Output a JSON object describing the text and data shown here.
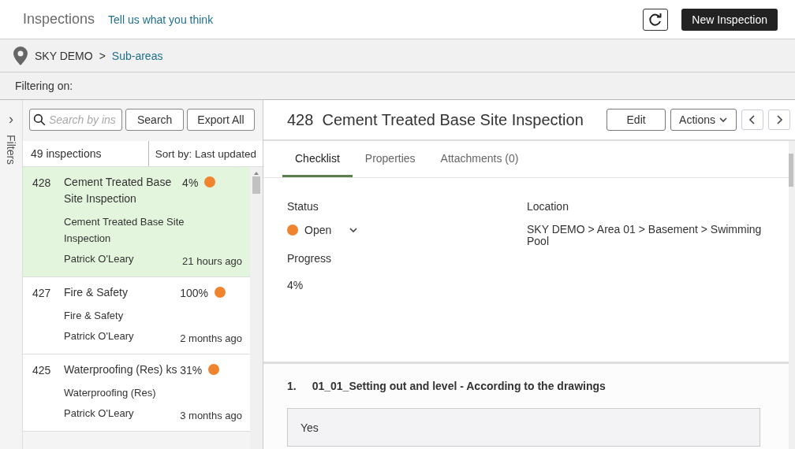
{
  "header": {
    "title": "Inspections",
    "feedback_link": "Tell us what you think",
    "new_button": "New Inspection"
  },
  "breadcrumb": {
    "root": "SKY DEMO",
    "separator": ">",
    "link": "Sub-areas"
  },
  "filter_bar": {
    "label": "Filtering on:"
  },
  "filters_rail": {
    "chevron": "›",
    "label": "Filters"
  },
  "list": {
    "search_placeholder": "Search by ins",
    "search_button": "Search",
    "export_button": "Export All",
    "count": "49 inspections",
    "sort": "Sort by: Last updated",
    "items": [
      {
        "number": "428",
        "title": "Cement Treated Base Site Inspection",
        "template": "Cement Treated Base Site Inspection",
        "author": "Patrick O'Leary",
        "time": "21 hours ago",
        "progress": "4%",
        "color": "#f0832d",
        "selected": true
      },
      {
        "number": "427",
        "title": "Fire & Safety",
        "template": "Fire & Safety",
        "author": "Patrick O'Leary",
        "time": "2 months ago",
        "progress": "100%",
        "color": "#f0832d",
        "selected": false
      },
      {
        "number": "425",
        "title": "Waterproofing (Res) ks",
        "template": "Waterproofing (Res)",
        "author": "Patrick O'Leary",
        "time": "3 months ago",
        "progress": "31%",
        "color": "#f0832d",
        "selected": false
      }
    ]
  },
  "detail": {
    "number": "428",
    "title": "Cement Treated Base Site Inspection",
    "edit_button": "Edit",
    "actions_button": "Actions",
    "tabs": [
      {
        "label": "Checklist",
        "selected": true
      },
      {
        "label": "Properties",
        "selected": false
      },
      {
        "label": "Attachments (0)",
        "selected": false
      }
    ],
    "status_label": "Status",
    "status": {
      "value": "Open",
      "color": "#f0832d"
    },
    "location_label": "Location",
    "location": "SKY DEMO > Area 01 > Basement > Swimming Pool",
    "progress_label": "Progress",
    "progress": "4%",
    "checklist": [
      {
        "index": "1.",
        "question": "01_01_Setting out and level - According to the drawings",
        "answer": "Yes"
      }
    ]
  }
}
